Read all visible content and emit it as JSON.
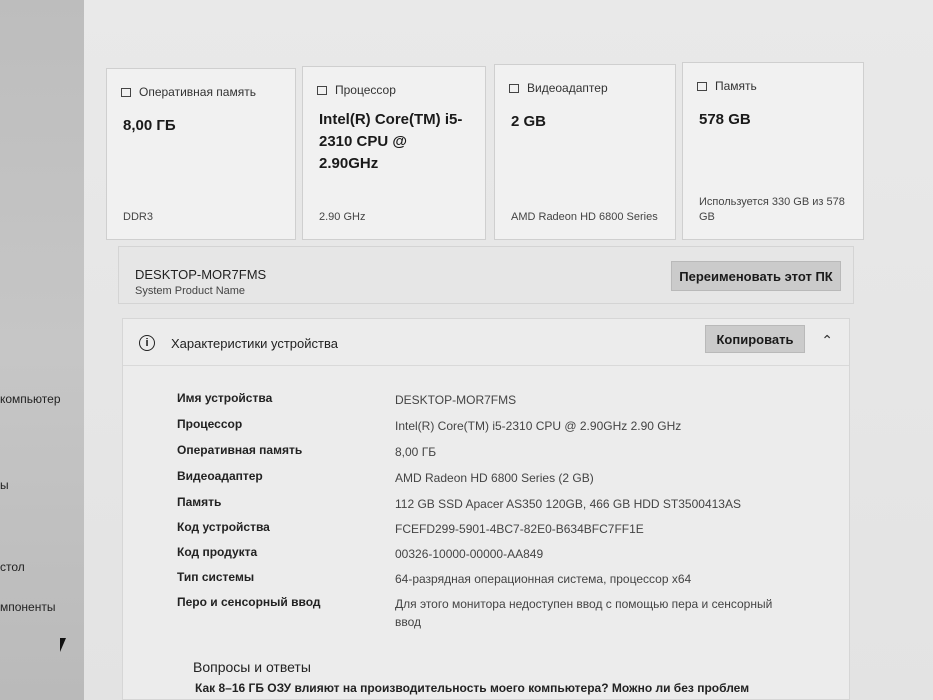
{
  "sidebar": {
    "items": [
      {
        "label": "компьютер"
      },
      {
        "label": "ы"
      },
      {
        "label": "стол"
      },
      {
        "label": "мпоненты"
      }
    ]
  },
  "cards": [
    {
      "title": "Оперативная память",
      "icon": "memory-icon",
      "value": "8,00 ГБ",
      "detail": "DDR3"
    },
    {
      "title": "Процессор",
      "icon": "processor-icon",
      "value": "Intel(R) Core(TM) i5-2310 CPU @ 2.90GHz",
      "detail": "2.90 GHz"
    },
    {
      "title": "Видеоадаптер",
      "icon": "display-adapter-icon",
      "value": "2 GB",
      "detail": "AMD Radeon HD 6800 Series"
    },
    {
      "title": "Память",
      "icon": "storage-icon",
      "value": "578 GB",
      "detail": "Используется 330 GB из 578 GB"
    }
  ],
  "device_name_bar": {
    "name": "DESKTOP-MOR7FMS",
    "subtitle": "System Product Name",
    "rename_label": "Переименовать этот ПК"
  },
  "specs": {
    "title": "Характеристики устройства",
    "copy_label": "Копировать",
    "rows": [
      {
        "label": "Имя устройства",
        "value": "DESKTOP-MOR7FMS"
      },
      {
        "label": "Процессор",
        "value": "Intel(R) Core(TM) i5-2310 CPU @ 2.90GHz   2.90 GHz"
      },
      {
        "label": "Оперативная память",
        "value": "8,00 ГБ"
      },
      {
        "label": "Видеоадаптер",
        "value": "AMD Radeon HD 6800 Series (2 GB)"
      },
      {
        "label": "Память",
        "value": "112 GB SSD Apacer AS350 120GB, 466 GB HDD ST3500413AS"
      },
      {
        "label": "Код устройства",
        "value": "FCEFD299-5901-4BC7-82E0-B634BFC7FF1E"
      },
      {
        "label": "Код продукта",
        "value": "00326-10000-00000-AA849"
      },
      {
        "label": "Тип системы",
        "value": "64-разрядная операционная система, процессор x64"
      },
      {
        "label": "Перо и сенсорный ввод",
        "value": "Для этого монитора недоступен ввод с помощью пера и сенсорный ввод"
      }
    ]
  },
  "qa": {
    "title": "Вопросы и ответы",
    "question": "Как 8–16 ГБ ОЗУ влияют на производительность моего компьютера? Можно ли без проблем"
  }
}
